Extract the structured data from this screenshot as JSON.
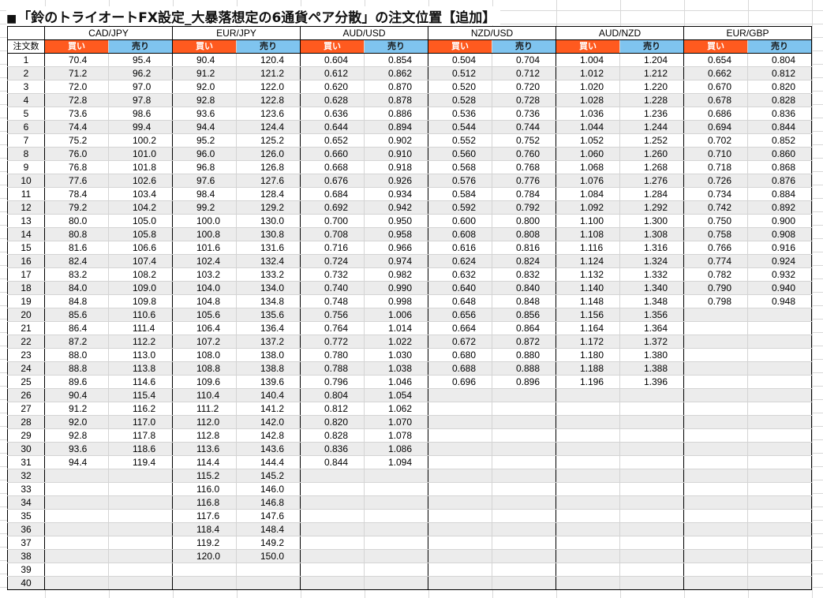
{
  "title": "「鈴のトライオートFX設定_大暴落想定の6通貨ペア分散」の注文位置【追加】",
  "title_mark": "■",
  "row_header": "注文数",
  "buy_label": "買い",
  "sell_label": "売り",
  "colors": {
    "buy": "#ff5a1f",
    "sell": "#7fc4ef",
    "alt_row": "#ececec"
  },
  "pairs": [
    {
      "name": "CAD/JPY",
      "buy": [
        "70.4",
        "71.2",
        "72.0",
        "72.8",
        "73.6",
        "74.4",
        "75.2",
        "76.0",
        "76.8",
        "77.6",
        "78.4",
        "79.2",
        "80.0",
        "80.8",
        "81.6",
        "82.4",
        "83.2",
        "84.0",
        "84.8",
        "85.6",
        "86.4",
        "87.2",
        "88.0",
        "88.8",
        "89.6",
        "90.4",
        "91.2",
        "92.0",
        "92.8",
        "93.6",
        "94.4"
      ],
      "sell": [
        "95.4",
        "96.2",
        "97.0",
        "97.8",
        "98.6",
        "99.4",
        "100.2",
        "101.0",
        "101.8",
        "102.6",
        "103.4",
        "104.2",
        "105.0",
        "105.8",
        "106.6",
        "107.4",
        "108.2",
        "109.0",
        "109.8",
        "110.6",
        "111.4",
        "112.2",
        "113.0",
        "113.8",
        "114.6",
        "115.4",
        "116.2",
        "117.0",
        "117.8",
        "118.6",
        "119.4"
      ]
    },
    {
      "name": "EUR/JPY",
      "buy": [
        "90.4",
        "91.2",
        "92.0",
        "92.8",
        "93.6",
        "94.4",
        "95.2",
        "96.0",
        "96.8",
        "97.6",
        "98.4",
        "99.2",
        "100.0",
        "100.8",
        "101.6",
        "102.4",
        "103.2",
        "104.0",
        "104.8",
        "105.6",
        "106.4",
        "107.2",
        "108.0",
        "108.8",
        "109.6",
        "110.4",
        "111.2",
        "112.0",
        "112.8",
        "113.6",
        "114.4",
        "115.2",
        "116.0",
        "116.8",
        "117.6",
        "118.4",
        "119.2",
        "120.0"
      ],
      "sell": [
        "120.4",
        "121.2",
        "122.0",
        "122.8",
        "123.6",
        "124.4",
        "125.2",
        "126.0",
        "126.8",
        "127.6",
        "128.4",
        "129.2",
        "130.0",
        "130.8",
        "131.6",
        "132.4",
        "133.2",
        "134.0",
        "134.8",
        "135.6",
        "136.4",
        "137.2",
        "138.0",
        "138.8",
        "139.6",
        "140.4",
        "141.2",
        "142.0",
        "142.8",
        "143.6",
        "144.4",
        "145.2",
        "146.0",
        "146.8",
        "147.6",
        "148.4",
        "149.2",
        "150.0"
      ]
    },
    {
      "name": "AUD/USD",
      "buy": [
        "0.604",
        "0.612",
        "0.620",
        "0.628",
        "0.636",
        "0.644",
        "0.652",
        "0.660",
        "0.668",
        "0.676",
        "0.684",
        "0.692",
        "0.700",
        "0.708",
        "0.716",
        "0.724",
        "0.732",
        "0.740",
        "0.748",
        "0.756",
        "0.764",
        "0.772",
        "0.780",
        "0.788",
        "0.796",
        "0.804",
        "0.812",
        "0.820",
        "0.828",
        "0.836",
        "0.844"
      ],
      "sell": [
        "0.854",
        "0.862",
        "0.870",
        "0.878",
        "0.886",
        "0.894",
        "0.902",
        "0.910",
        "0.918",
        "0.926",
        "0.934",
        "0.942",
        "0.950",
        "0.958",
        "0.966",
        "0.974",
        "0.982",
        "0.990",
        "0.998",
        "1.006",
        "1.014",
        "1.022",
        "1.030",
        "1.038",
        "1.046",
        "1.054",
        "1.062",
        "1.070",
        "1.078",
        "1.086",
        "1.094"
      ]
    },
    {
      "name": "NZD/USD",
      "buy": [
        "0.504",
        "0.512",
        "0.520",
        "0.528",
        "0.536",
        "0.544",
        "0.552",
        "0.560",
        "0.568",
        "0.576",
        "0.584",
        "0.592",
        "0.600",
        "0.608",
        "0.616",
        "0.624",
        "0.632",
        "0.640",
        "0.648",
        "0.656",
        "0.664",
        "0.672",
        "0.680",
        "0.688",
        "0.696"
      ],
      "sell": [
        "0.704",
        "0.712",
        "0.720",
        "0.728",
        "0.736",
        "0.744",
        "0.752",
        "0.760",
        "0.768",
        "0.776",
        "0.784",
        "0.792",
        "0.800",
        "0.808",
        "0.816",
        "0.824",
        "0.832",
        "0.840",
        "0.848",
        "0.856",
        "0.864",
        "0.872",
        "0.880",
        "0.888",
        "0.896"
      ]
    },
    {
      "name": "AUD/NZD",
      "buy": [
        "1.004",
        "1.012",
        "1.020",
        "1.028",
        "1.036",
        "1.044",
        "1.052",
        "1.060",
        "1.068",
        "1.076",
        "1.084",
        "1.092",
        "1.100",
        "1.108",
        "1.116",
        "1.124",
        "1.132",
        "1.140",
        "1.148",
        "1.156",
        "1.164",
        "1.172",
        "1.180",
        "1.188",
        "1.196"
      ],
      "sell": [
        "1.204",
        "1.212",
        "1.220",
        "1.228",
        "1.236",
        "1.244",
        "1.252",
        "1.260",
        "1.268",
        "1.276",
        "1.284",
        "1.292",
        "1.300",
        "1.308",
        "1.316",
        "1.324",
        "1.332",
        "1.340",
        "1.348",
        "1.356",
        "1.364",
        "1.372",
        "1.380",
        "1.388",
        "1.396"
      ]
    },
    {
      "name": "EUR/GBP",
      "buy": [
        "0.654",
        "0.662",
        "0.670",
        "0.678",
        "0.686",
        "0.694",
        "0.702",
        "0.710",
        "0.718",
        "0.726",
        "0.734",
        "0.742",
        "0.750",
        "0.758",
        "0.766",
        "0.774",
        "0.782",
        "0.790",
        "0.798"
      ],
      "sell": [
        "0.804",
        "0.812",
        "0.820",
        "0.828",
        "0.836",
        "0.844",
        "0.852",
        "0.860",
        "0.868",
        "0.876",
        "0.884",
        "0.892",
        "0.900",
        "0.908",
        "0.916",
        "0.924",
        "0.932",
        "0.940",
        "0.948"
      ]
    }
  ],
  "order_numbers": [
    "1",
    "2",
    "3",
    "4",
    "5",
    "6",
    "7",
    "8",
    "9",
    "10",
    "11",
    "12",
    "13",
    "14",
    "15",
    "16",
    "17",
    "18",
    "19",
    "20",
    "21",
    "22",
    "23",
    "24",
    "25",
    "26",
    "27",
    "28",
    "29",
    "30",
    "31",
    "32",
    "33",
    "34",
    "35",
    "36",
    "37",
    "38",
    "39",
    "40"
  ]
}
